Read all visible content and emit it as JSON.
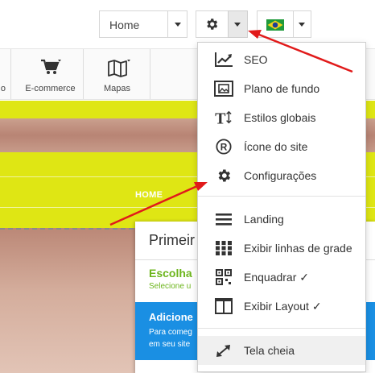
{
  "header": {
    "page_select_value": "Home",
    "settings_icon": "gear-icon",
    "language_flag": "brazil-flag"
  },
  "toolbar": {
    "prev_label_fragment": "o",
    "ecommerce_label": "E-commerce",
    "maps_label": "Mapas"
  },
  "preview": {
    "nav_home": "HOME",
    "panel_title": "Primeir",
    "step1_title": "Escolha",
    "step1_sub": "Selecione u",
    "step2_title": "Adicione",
    "step2_desc1": "Para comeg",
    "step2_desc2": "em seu site",
    "colors": {
      "highlight": "#dfe614",
      "green": "#6cb51c",
      "blue": "#1a8fe3"
    }
  },
  "menu": {
    "items": [
      {
        "label": "SEO",
        "icon": "trend-chart-icon"
      },
      {
        "label": "Plano de fundo",
        "icon": "background-image-icon"
      },
      {
        "label": "Estilos globais",
        "icon": "text-style-icon"
      },
      {
        "label": "Ícone do site",
        "icon": "registered-icon"
      },
      {
        "label": "Configurações",
        "icon": "gear-icon"
      },
      {
        "label": "Landing",
        "icon": "hamburger-icon"
      },
      {
        "label": "Exibir linhas de grade",
        "icon": "grid-icon"
      },
      {
        "label": "Enquadrar ✓",
        "icon": "qr-frame-icon"
      },
      {
        "label": "Exibir Layout ✓",
        "icon": "layout-columns-icon"
      },
      {
        "label": "Tela cheia",
        "icon": "fullscreen-expand-icon"
      }
    ]
  },
  "annotation_color": "#e11a1a"
}
